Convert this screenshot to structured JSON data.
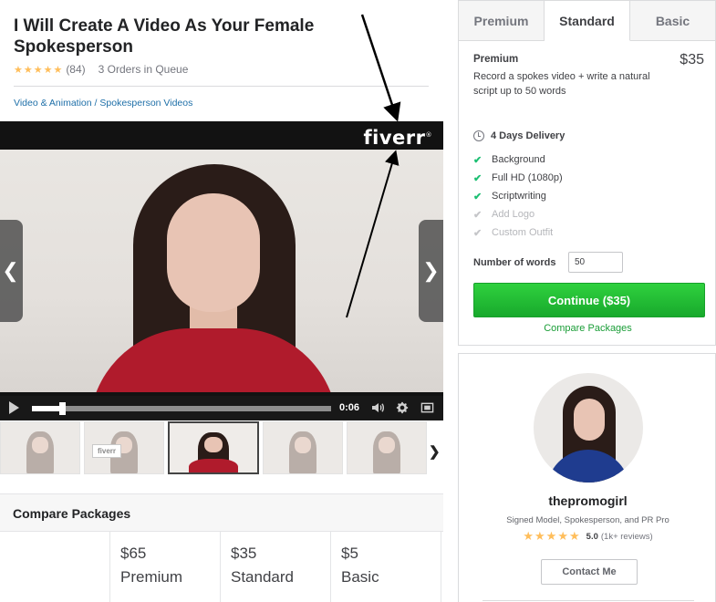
{
  "gig": {
    "title": "I Will Create A Video As Your Female Spokesperson",
    "stars": "★★★★★",
    "rating_count": "(84)",
    "orders_in_queue": "3 Orders in Queue",
    "breadcrumb": [
      "Video & Animation",
      "Spokesperson Videos"
    ],
    "breadcrumb_sep": " / "
  },
  "video": {
    "watermark": "fiverr",
    "watermark_mark": "®",
    "time": "0:06",
    "progress": 0.1
  },
  "thumbnails": [
    {
      "caption": ""
    },
    {
      "caption": "fiverr"
    },
    {
      "caption": "",
      "selected": true
    },
    {
      "caption": ""
    },
    {
      "caption": ""
    }
  ],
  "compare": {
    "title": "Compare Packages",
    "columns": [
      {
        "price": "$65",
        "name": "Premium"
      },
      {
        "price": "$35",
        "name": "Standard"
      },
      {
        "price": "$5",
        "name": "Basic"
      }
    ]
  },
  "package_panel": {
    "tabs": [
      {
        "label": "Premium",
        "active": false
      },
      {
        "label": "Standard",
        "active": true
      },
      {
        "label": "Basic",
        "active": false
      }
    ],
    "package_name": "Premium",
    "price": "$35",
    "description": "Record a spokes video + write a natural script up to 50 words",
    "delivery": "4 Days Delivery",
    "features": [
      {
        "label": "Background",
        "included": true
      },
      {
        "label": "Full HD (1080p)",
        "included": true
      },
      {
        "label": "Scriptwriting",
        "included": true
      },
      {
        "label": "Add Logo",
        "included": false
      },
      {
        "label": "Custom Outfit",
        "included": false
      }
    ],
    "words_label": "Number of words",
    "words_value": "50",
    "continue_label": "Continue ($35)",
    "compare_link": "Compare Packages"
  },
  "seller": {
    "username": "thepromogirl",
    "tagline": "Signed Model, Spokesperson, and PR Pro",
    "stars": "★★★★★",
    "score": "5.0",
    "reviews": "(1k+ reviews)",
    "contact_label": "Contact Me"
  },
  "colors": {
    "accent_green": "#1dbf73",
    "button_green": "#18a92c",
    "star_yellow": "#ffbe5b",
    "link_blue": "#1e6fa8"
  },
  "icons": [
    "chevron-left-icon",
    "chevron-right-icon",
    "play-icon",
    "volume-icon",
    "gear-icon",
    "fullscreen-icon",
    "clock-icon",
    "check-icon"
  ]
}
